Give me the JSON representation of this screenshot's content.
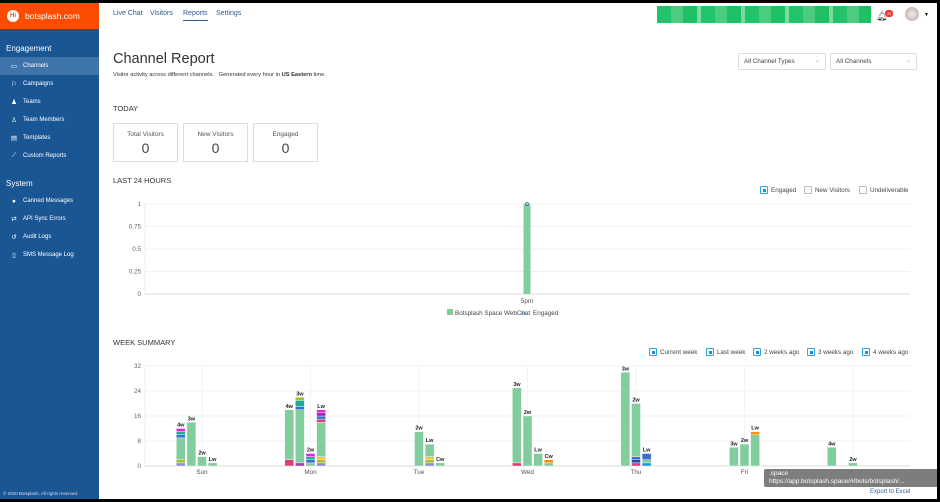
{
  "brand": {
    "name": "botsplash.com",
    "logo_text": "Hi"
  },
  "sidebar": {
    "engagement_title": "Engagement",
    "engagement": [
      {
        "label": "Channels",
        "icon": "inbox-icon",
        "glyph": "▭",
        "active": true
      },
      {
        "label": "Campaigns",
        "icon": "flag-icon",
        "glyph": "⚐"
      },
      {
        "label": "Teams",
        "icon": "users-icon",
        "glyph": "♟"
      },
      {
        "label": "Team Members",
        "icon": "user-icon",
        "glyph": "♙"
      },
      {
        "label": "Templates",
        "icon": "file-icon",
        "glyph": "▤"
      },
      {
        "label": "Custom Reports",
        "icon": "chart-icon",
        "glyph": "⟋"
      }
    ],
    "system_title": "System",
    "system": [
      {
        "label": "Canned Messages",
        "icon": "comment-icon",
        "glyph": "●"
      },
      {
        "label": "API Sync Errors",
        "icon": "exchange-icon",
        "glyph": "⇄"
      },
      {
        "label": "Audit Logs",
        "icon": "history-icon",
        "glyph": "↺"
      },
      {
        "label": "SMS Message Log",
        "icon": "mobile-icon",
        "glyph": "▯"
      }
    ],
    "copyright": "© 2020 Botsplash. All rights reserved."
  },
  "nav": [
    "Live Chat",
    "Visitors",
    "Reports",
    "Settings"
  ],
  "nav_active": "Reports",
  "header": {
    "notification_count": "22"
  },
  "page": {
    "title": "Channel Report",
    "subtitle_pre": "Visitor activity across different channels.   Generated every hour in ",
    "subtitle_bold": "US Eastern",
    "subtitle_post": " time."
  },
  "filters": {
    "channel_types": "All Channel Types",
    "channels": "All Channels"
  },
  "today": {
    "title": "TODAY",
    "cards": [
      {
        "label": "Total Visitors",
        "value": "0"
      },
      {
        "label": "New Visitors",
        "value": "0"
      },
      {
        "label": "Engaged",
        "value": "0"
      }
    ]
  },
  "last24": {
    "title": "LAST 24 HOURS",
    "toggles": [
      {
        "label": "Engaged",
        "checked": true
      },
      {
        "label": "New Visitors",
        "checked": false
      },
      {
        "label": "Undeliverable",
        "checked": false
      }
    ]
  },
  "week": {
    "title": "WEEK SUMMARY",
    "export": "Export to Excel"
  },
  "tooltip": {
    "line1": ".space",
    "line2": "https://app.botsplash.space/#/bots/botsplash/..."
  },
  "colors": {
    "sidebar": "#1a5694",
    "brand": "#fc4c02",
    "bar_green": "#82cc9e",
    "accent": "#29a9e0"
  },
  "chart_data": [
    {
      "type": "bar",
      "title": "LAST 24 HOURS",
      "categories": [
        "5pm"
      ],
      "ylim": [
        0,
        1
      ],
      "yticks": [
        "0",
        "0.25",
        "0.5",
        "0.75",
        "1"
      ],
      "series": [
        {
          "name": "Botsplash Space WebChat",
          "values": [
            1
          ],
          "color": "#82cc9e"
        }
      ],
      "line_series": [
        {
          "name": "Engaged",
          "values": [
            1
          ],
          "color": "#4a7fc1"
        }
      ],
      "legend": "bottom",
      "grid": true
    },
    {
      "type": "bar",
      "stacked": true,
      "title": "WEEK SUMMARY",
      "categories": [
        "Sun",
        "Mon",
        "Tue",
        "Wed",
        "Thu",
        "Fri",
        "Sat"
      ],
      "ylim": [
        0,
        32
      ],
      "yticks": [
        "0",
        "8",
        "16",
        "24",
        "32"
      ],
      "legend": [
        "Current week",
        "Last week",
        "2 weeks ago",
        "3 weeks ago",
        "4 weeks ago"
      ],
      "legend_placement": "top-right",
      "grid": true,
      "slots": [
        "4w",
        "3w",
        "2w",
        "Lw",
        "Cw"
      ],
      "bars": [
        {
          "day": "Sun",
          "label": "4w",
          "segments": [
            [
              1,
              "#8c8ce0"
            ],
            [
              1,
              "#a8c02a"
            ],
            [
              7,
              "#82cc9e"
            ],
            [
              1,
              "#3a6fd0"
            ],
            [
              1,
              "#1faa9a"
            ],
            [
              1,
              "#d82ae0"
            ]
          ]
        },
        {
          "day": "Sun",
          "label": "3w",
          "segments": [
            [
              14,
              "#82cc9e"
            ]
          ]
        },
        {
          "day": "Sun",
          "label": "2w",
          "segments": [
            [
              3,
              "#82cc9e"
            ]
          ]
        },
        {
          "day": "Sun",
          "label": "Lw",
          "segments": [
            [
              1,
              "#82cc9e"
            ]
          ]
        },
        {
          "day": "Mon",
          "label": "4w",
          "segments": [
            [
              2,
              "#e03c78"
            ],
            [
              16,
              "#82cc9e"
            ]
          ]
        },
        {
          "day": "Mon",
          "label": "3w",
          "segments": [
            [
              1,
              "#a03cb0"
            ],
            [
              17,
              "#82cc9e"
            ],
            [
              1,
              "#3a6fd0"
            ],
            [
              2,
              "#1faa9a"
            ],
            [
              1,
              "#a8c02a"
            ]
          ]
        },
        {
          "day": "Mon",
          "label": "2w",
          "segments": [
            [
              1,
              "#82cc9e"
            ],
            [
              1,
              "#3a6fd0"
            ],
            [
              1,
              "#1faa9a"
            ],
            [
              1,
              "#d82ae0"
            ]
          ]
        },
        {
          "day": "Mon",
          "label": "Lw",
          "segments": [
            [
              1,
              "#8c8ce0"
            ],
            [
              1,
              "#a8c02a"
            ],
            [
              1,
              "#f5c04a"
            ],
            [
              11,
              "#82cc9e"
            ],
            [
              1,
              "#e03c78"
            ],
            [
              1,
              "#3a6fd0"
            ],
            [
              1,
              "#a01ab0"
            ],
            [
              1,
              "#d82ae0"
            ]
          ]
        },
        {
          "day": "Tue",
          "label": "2w",
          "segments": [
            [
              11,
              "#82cc9e"
            ]
          ]
        },
        {
          "day": "Tue",
          "label": "Lw",
          "segments": [
            [
              1,
              "#8c8ce0"
            ],
            [
              1,
              "#a8c02a"
            ],
            [
              1,
              "#f5c04a"
            ],
            [
              4,
              "#82cc9e"
            ]
          ]
        },
        {
          "day": "Tue",
          "label": "Cw",
          "segments": [
            [
              1,
              "#82cc9e"
            ]
          ]
        },
        {
          "day": "Wed",
          "label": "3w",
          "segments": [
            [
              1,
              "#e03c78"
            ],
            [
              24,
              "#82cc9e"
            ]
          ]
        },
        {
          "day": "Wed",
          "label": "2w",
          "segments": [
            [
              16,
              "#82cc9e"
            ]
          ]
        },
        {
          "day": "Wed",
          "label": "Lw",
          "segments": [
            [
              4,
              "#82cc9e"
            ]
          ]
        },
        {
          "day": "Wed",
          "label": "Cw",
          "segments": [
            [
              1,
              "#82cc9e"
            ],
            [
              1,
              "#f5900a"
            ]
          ]
        },
        {
          "day": "Thu",
          "label": "3w",
          "segments": [
            [
              30,
              "#82cc9e"
            ]
          ]
        },
        {
          "day": "Thu",
          "label": "2w",
          "segments": [
            [
              1,
              "#e03c78"
            ],
            [
              1,
              "#2c4f9a"
            ],
            [
              1,
              "#3a6fd0"
            ],
            [
              17,
              "#82cc9e"
            ]
          ]
        },
        {
          "day": "Thu",
          "label": "Lw",
          "segments": [
            [
              1,
              "#1e9ad0"
            ],
            [
              1,
              "#82cc9e"
            ],
            [
              2,
              "#3a6fd0"
            ]
          ]
        },
        {
          "day": "Fri",
          "label": "3w",
          "segments": [
            [
              6,
              "#82cc9e"
            ]
          ]
        },
        {
          "day": "Fri",
          "label": "2w",
          "segments": [
            [
              7,
              "#82cc9e"
            ]
          ]
        },
        {
          "day": "Fri",
          "label": "Lw",
          "segments": [
            [
              10,
              "#82cc9e"
            ],
            [
              1,
              "#f5900a"
            ]
          ]
        },
        {
          "day": "Sat",
          "label": "4w",
          "segments": [
            [
              6,
              "#82cc9e"
            ]
          ]
        },
        {
          "day": "Sat",
          "label": "2w",
          "segments": [
            [
              1,
              "#82cc9e"
            ]
          ]
        }
      ]
    }
  ]
}
